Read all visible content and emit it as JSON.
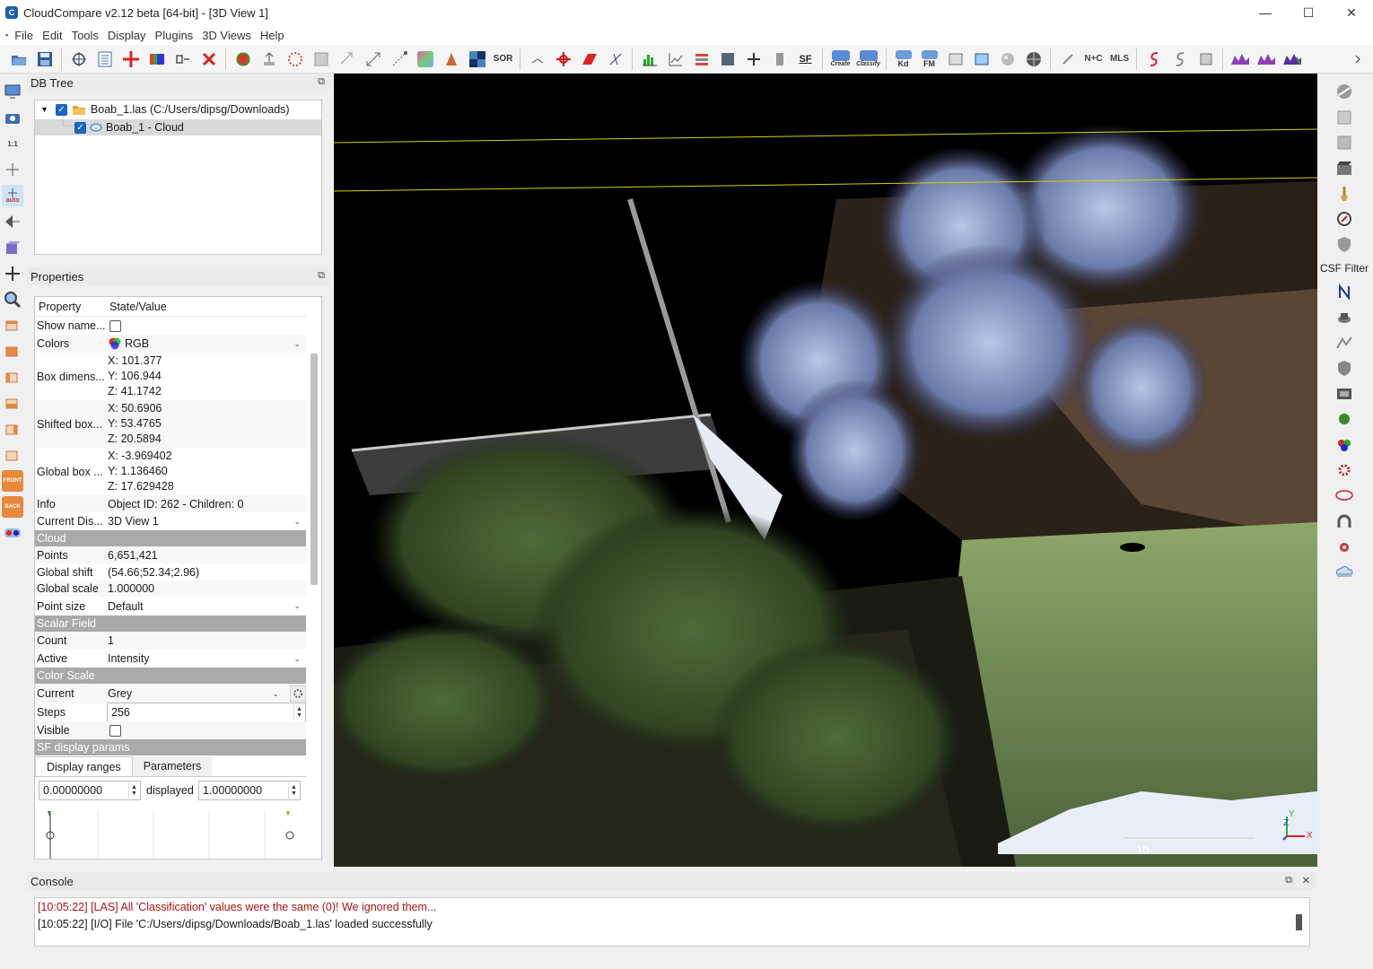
{
  "window": {
    "title": "CloudCompare v2.12 beta [64-bit] - [3D View 1]",
    "minimize": "—",
    "maximize": "☐",
    "close": "✕"
  },
  "menu": [
    "File",
    "Edit",
    "Tools",
    "Display",
    "Plugins",
    "3D Views",
    "Help"
  ],
  "toolbar": {
    "sor_label": "SOR",
    "sf_label": "SF",
    "kd_label": "Kd",
    "fm_label": "FM",
    "nc_label": "N+C",
    "mls_label": "MLS",
    "canupo_create": "Create",
    "canupo_classify": "Classify"
  },
  "left_toolbar": {
    "one_to_one": "1:1",
    "auto_label": "auto",
    "front_label": "FRONT",
    "back_label": "BACK"
  },
  "right_toolbar": {
    "csf_filter_label": "CSF Filter"
  },
  "db_tree": {
    "title": "DB Tree",
    "items": [
      {
        "label": "Boab_1.las (C:/Users/dipsg/Downloads)",
        "checked": true
      },
      {
        "label": "Boab_1 - Cloud",
        "checked": true
      }
    ]
  },
  "properties": {
    "title": "Properties",
    "header_property": "Property",
    "header_value": "State/Value",
    "show_name": "Show name...",
    "colors_key": "Colors",
    "colors_value": "RGB",
    "box_dim_key": "Box dimens...",
    "box_dim": {
      "x": "X: 101.377",
      "y": "Y: 106.944",
      "z": "Z: 41.1742"
    },
    "shifted_key": "Shifted box...",
    "shifted": {
      "x": "X: 50.6906",
      "y": "Y: 53.4765",
      "z": "Z: 20.5894"
    },
    "global_box_key": "Global box ...",
    "global_box": {
      "x": "X: -3.969402",
      "y": "Y: 1.136460",
      "z": "Z: 17.629428"
    },
    "info_key": "Info",
    "info_value": "Object ID: 262 - Children: 0",
    "current_display_key": "Current Dis...",
    "current_display_value": "3D View 1",
    "section_cloud": "Cloud",
    "points_key": "Points",
    "points_value": "6,651,421",
    "global_shift_key": "Global shift",
    "global_shift_value": "(54.66;52.34;2.96)",
    "global_scale_key": "Global scale",
    "global_scale_value": "1.000000",
    "point_size_key": "Point size",
    "point_size_value": "Default",
    "section_sf": "Scalar Field",
    "count_key": "Count",
    "count_value": "1",
    "active_key": "Active",
    "active_value": "Intensity",
    "section_color_scale": "Color Scale",
    "current_key": "Current",
    "current_value": "Grey",
    "steps_key": "Steps",
    "steps_value": "256",
    "visible_key": "Visible",
    "section_sf_display": "SF display params",
    "tab_display_ranges": "Display ranges",
    "tab_parameters": "Parameters",
    "range_min": "0.00000000",
    "displayed_label": "displayed",
    "range_max": "1.00000000"
  },
  "view": {
    "scale_label": "10",
    "axis_x": "X",
    "axis_y": "Y",
    "axis_z": "Z"
  },
  "console": {
    "title": "Console",
    "lines": [
      {
        "text": "[10:05:22] [LAS] All 'Classification' values were the same (0)! We ignored them...",
        "color": "#b01010"
      },
      {
        "text": "[10:05:22] [I/O] File 'C:/Users/dipsg/Downloads/Boab_1.las' loaded successfully",
        "color": "#1a1a1a"
      }
    ]
  }
}
